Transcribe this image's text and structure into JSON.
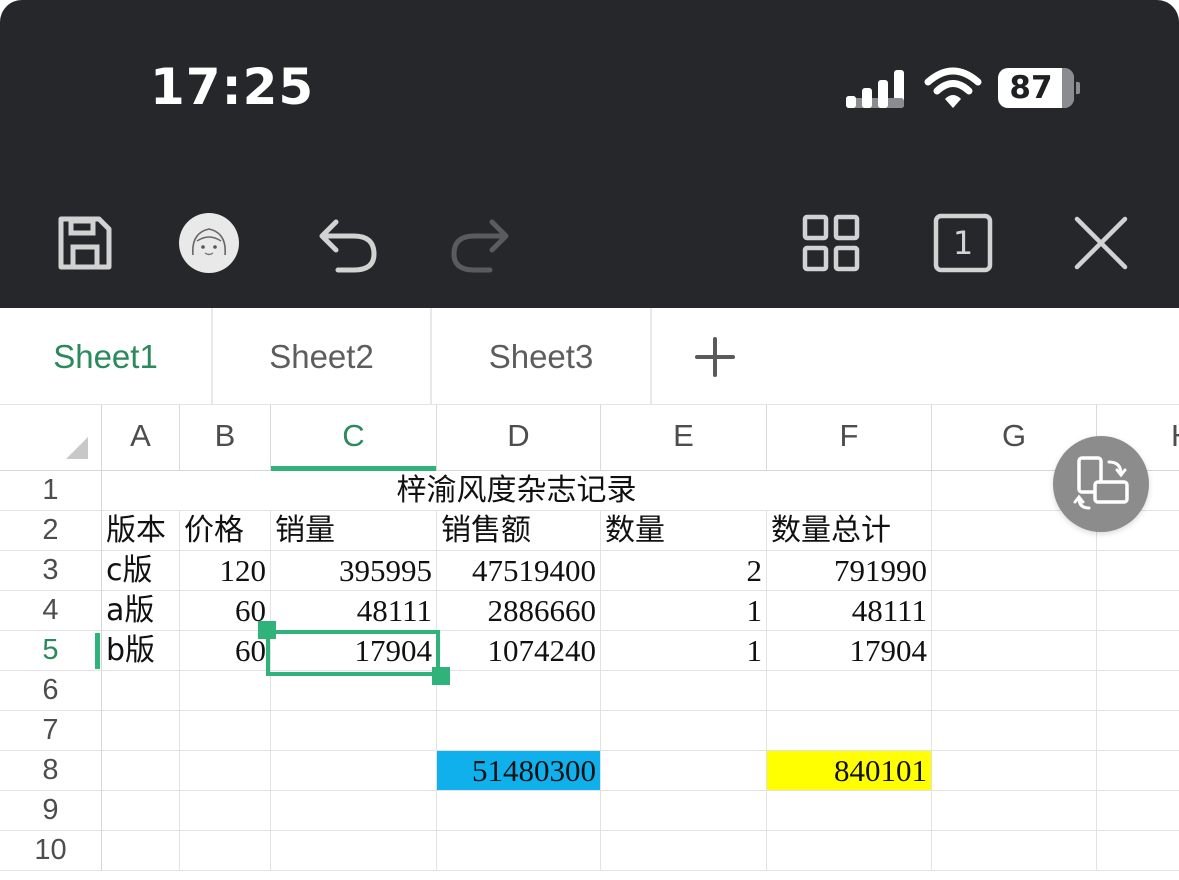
{
  "status_bar": {
    "time": "17:25",
    "battery": "87",
    "icons": [
      "cellular-signal-icon",
      "wifi-icon",
      "battery-icon"
    ]
  },
  "toolbar": {
    "icons": [
      "save-icon",
      "avatar-icon",
      "undo-icon",
      "redo-icon",
      "grid-view-icon",
      "page-count-icon",
      "close-icon"
    ],
    "page_count": "1"
  },
  "sheets": {
    "tabs": [
      "Sheet1",
      "Sheet2",
      "Sheet3"
    ],
    "active": "Sheet1",
    "add_icon": "plus-icon"
  },
  "spreadsheet": {
    "columns": [
      "A",
      "B",
      "C",
      "D",
      "E",
      "F",
      "G",
      "H"
    ],
    "rows": [
      "1",
      "2",
      "3",
      "4",
      "5",
      "6",
      "7",
      "8",
      "9",
      "10"
    ],
    "selected_cell": "C5",
    "title": "梓渝风度杂志记录",
    "headers": [
      "版本",
      "价格",
      "销量",
      "销售额",
      "数量",
      "数量总计"
    ],
    "data": [
      [
        "c版",
        "120",
        "395995",
        "47519400",
        "2",
        "791990"
      ],
      [
        "a版",
        "60",
        "48111",
        "2886660",
        "1",
        "48111"
      ],
      [
        "b版",
        "60",
        "17904",
        "1074240",
        "1",
        "17904"
      ]
    ],
    "totals": {
      "D8": "51480300",
      "F8": "840101"
    },
    "highlight_colors": {
      "D8": "#0fb0ec",
      "F8": "#ffff00"
    },
    "accent": "#2fb37a"
  },
  "floating_button": {
    "icon": "switch-layout-icon"
  }
}
